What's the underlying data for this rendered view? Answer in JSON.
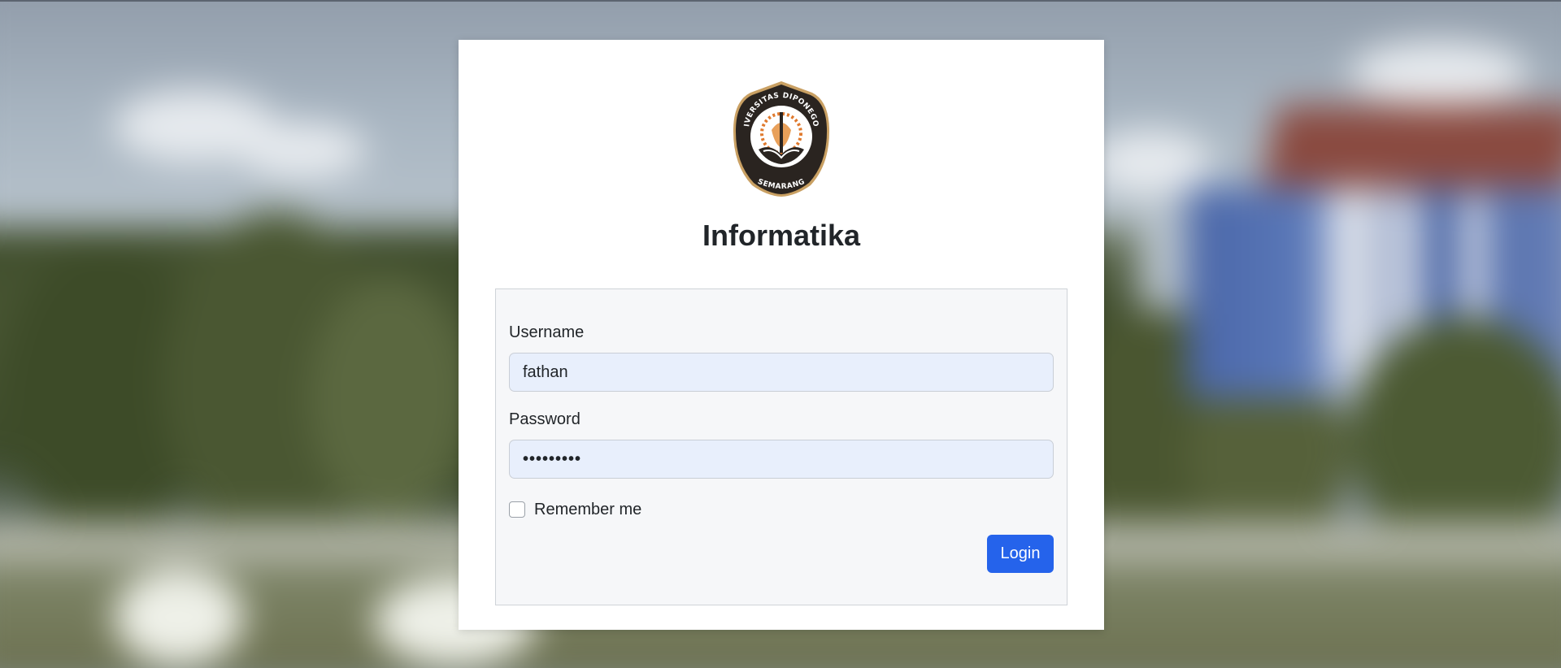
{
  "page": {
    "title": "Informatika",
    "logo_text_top": "UNIVERSITAS DIPONEGORO",
    "logo_text_bottom": "SEMARANG"
  },
  "form": {
    "username_label": "Username",
    "username_value": "fathan",
    "password_label": "Password",
    "password_value": "•••••••••",
    "remember_label": "Remember me",
    "remember_checked": false,
    "login_label": "Login"
  },
  "colors": {
    "primary": "#2563eb",
    "input_autofill_bg": "#e8effc",
    "form_box_bg": "#f6f7f9",
    "logo_dark": "#2a2420",
    "logo_gold": "#c9a063",
    "logo_orange": "#e07a2e"
  },
  "icons": {
    "logo": "university-seal-icon"
  }
}
